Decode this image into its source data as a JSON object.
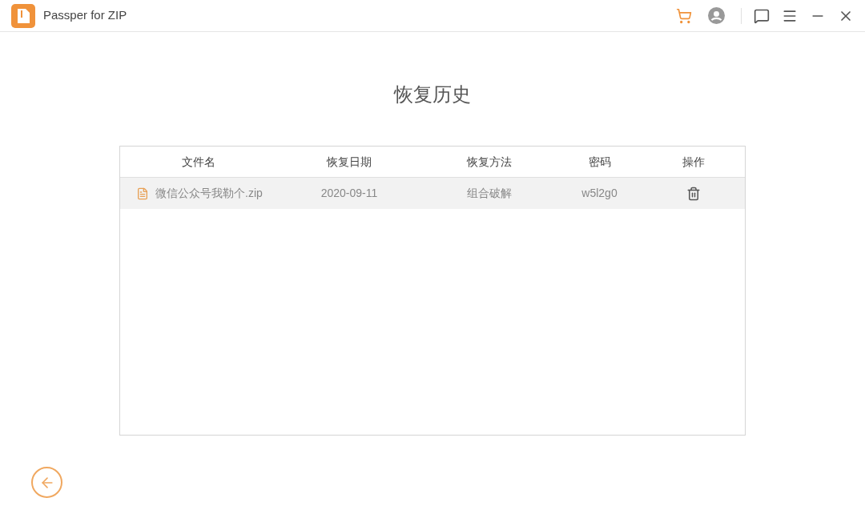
{
  "window": {
    "title": "Passper for ZIP"
  },
  "page": {
    "title": "恢复历史"
  },
  "table": {
    "columns": [
      "文件名",
      "恢复日期",
      "恢复方法",
      "密码",
      "操作"
    ],
    "rows": [
      {
        "file": "微信公众号我勒个.zip",
        "date": "2020-09-11",
        "method": "组合破解",
        "password": "w5l2g0"
      }
    ]
  }
}
